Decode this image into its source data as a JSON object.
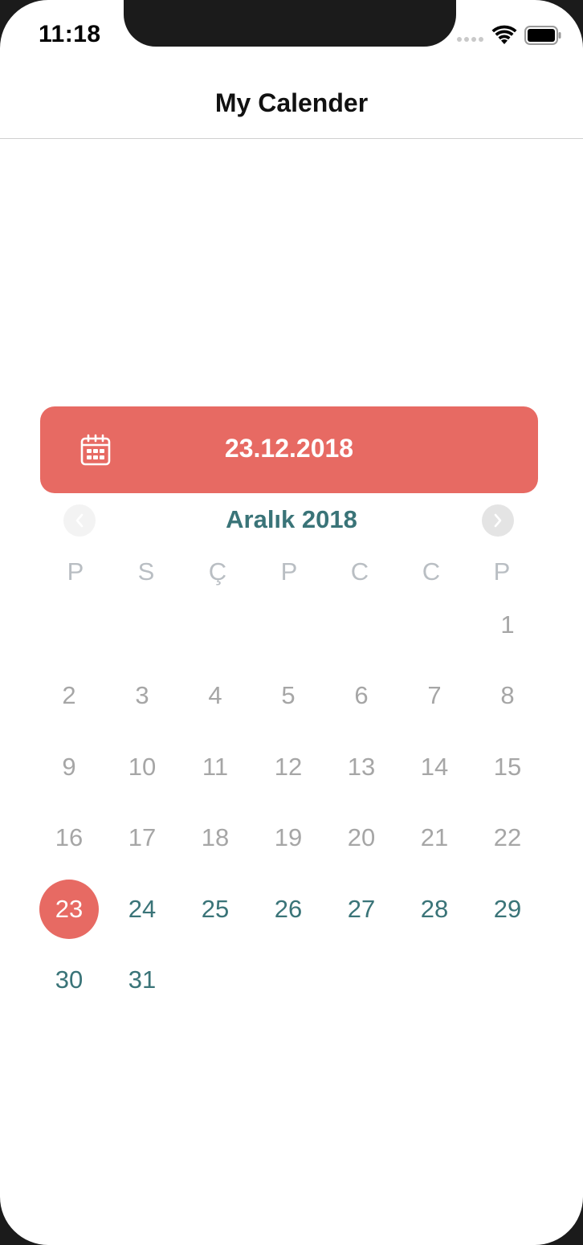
{
  "status_bar": {
    "time": "11:18",
    "icons": [
      "signal-dots-icon",
      "wifi-icon",
      "battery-icon"
    ]
  },
  "nav_bar": {
    "title": "My Calender"
  },
  "date_picker": {
    "selected_date": "23.12.2018",
    "icon": "calendar-icon",
    "accent_color": "#e76a63",
    "month_color": "#3a7478"
  },
  "calendar": {
    "month_label": "Aralık 2018",
    "prev_icon": "chevron-left-icon",
    "next_icon": "chevron-right-icon",
    "weekdays": [
      "P",
      "S",
      "Ç",
      "P",
      "C",
      "C",
      "P"
    ],
    "weeks": [
      [
        "",
        "",
        "",
        "",
        "",
        "",
        "1"
      ],
      [
        "2",
        "3",
        "4",
        "5",
        "6",
        "7",
        "8"
      ],
      [
        "9",
        "10",
        "11",
        "12",
        "13",
        "14",
        "15"
      ],
      [
        "16",
        "17",
        "18",
        "19",
        "20",
        "21",
        "22"
      ],
      [
        "23",
        "24",
        "25",
        "26",
        "27",
        "28",
        "29"
      ],
      [
        "30",
        "31",
        "",
        "",
        "",
        "",
        ""
      ]
    ],
    "selected_day": "23",
    "first_selectable_day": 23
  }
}
